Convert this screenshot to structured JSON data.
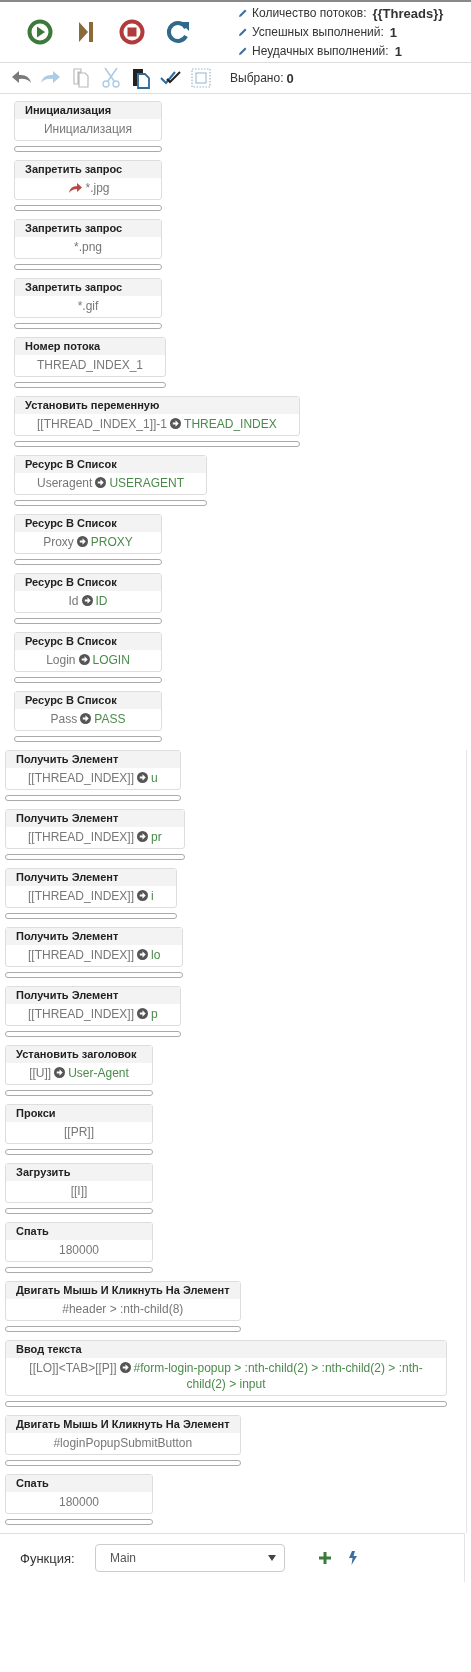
{
  "run_buttons": [
    {
      "kind": "play"
    },
    {
      "kind": "step"
    },
    {
      "kind": "stop"
    },
    {
      "kind": "reload"
    }
  ],
  "stats": [
    {
      "label": "Количество потоков:",
      "value": "{{Threads}}"
    },
    {
      "label": "Успешных выполнений:",
      "value": "1"
    },
    {
      "label": "Неудачных выполнений:",
      "value": "1"
    }
  ],
  "tools": [
    {
      "kind": "undo",
      "disabled": false
    },
    {
      "kind": "redo",
      "disabled": true
    },
    {
      "kind": "copy",
      "disabled": true
    },
    {
      "kind": "cut",
      "disabled": true
    },
    {
      "kind": "paste",
      "disabled": false
    },
    {
      "kind": "check",
      "disabled": false
    },
    {
      "kind": "select",
      "disabled": true
    }
  ],
  "selected_count": {
    "label": "Выбрано:",
    "value": "0"
  },
  "sections": [
    {
      "blocks": [
        {
          "title": "Инициализация",
          "value": "Инициализация"
        },
        {
          "title": "Запретить запрос",
          "kind": "redirect",
          "value": "*.jpg"
        },
        {
          "title": "Запретить запрос",
          "value": "*.png"
        },
        {
          "title": "Запретить запрос",
          "value": "*.gif"
        },
        {
          "title": "Номер потока",
          "value": "THREAD_INDEX_1"
        },
        {
          "title": "Установить переменную",
          "value": "[[THREAD_INDEX_1]]-1",
          "target": "THREAD_INDEX"
        },
        {
          "title": "Ресурс В Список",
          "value": "Useragent",
          "target": "USERAGENT"
        },
        {
          "title": "Ресурс В Список",
          "value": "Proxy",
          "target": "PROXY"
        },
        {
          "title": "Ресурс В Список",
          "value": "Id",
          "target": "ID"
        },
        {
          "title": "Ресурс В Список",
          "value": "Login",
          "target": "LOGIN"
        },
        {
          "title": "Ресурс В Список",
          "value": "Pass",
          "target": "PASS"
        }
      ]
    },
    {
      "blocks": [
        {
          "title": "Получить Элемент",
          "value": "[[THREAD_INDEX]]",
          "target": "u"
        },
        {
          "title": "Получить Элемент",
          "value": "[[THREAD_INDEX]]",
          "target": "pr"
        },
        {
          "title": "Получить Элемент",
          "value": "[[THREAD_INDEX]]",
          "target": "i"
        },
        {
          "title": "Получить Элемент",
          "value": "[[THREAD_INDEX]]",
          "target": "lo"
        },
        {
          "title": "Получить Элемент",
          "value": "[[THREAD_INDEX]]",
          "target": "p"
        },
        {
          "title": "Установить заголовок",
          "value": "[[U]]",
          "target": "User-Agent"
        },
        {
          "title": "Прокси",
          "value": "[[PR]]"
        },
        {
          "title": "Загрузить",
          "value": "[[I]]"
        },
        {
          "title": "Спать",
          "value": "180000"
        },
        {
          "title": "Двигать Мышь И Кликнуть На Элемент",
          "value": "#header > :nth-child(8)"
        },
        {
          "title": "Ввод текста",
          "value": "[[LO]]<TAB>[[P]]",
          "target": "#form-login-popup > :nth-child(2) > :nth-child(2) > :nth-child(2) > input"
        },
        {
          "title": "Двигать Мышь И Кликнуть На Элемент",
          "value": "#loginPopupSubmitButton"
        },
        {
          "title": "Спать",
          "value": "180000"
        }
      ]
    }
  ],
  "function_bar": {
    "label": "Функция:",
    "value": "Main"
  }
}
